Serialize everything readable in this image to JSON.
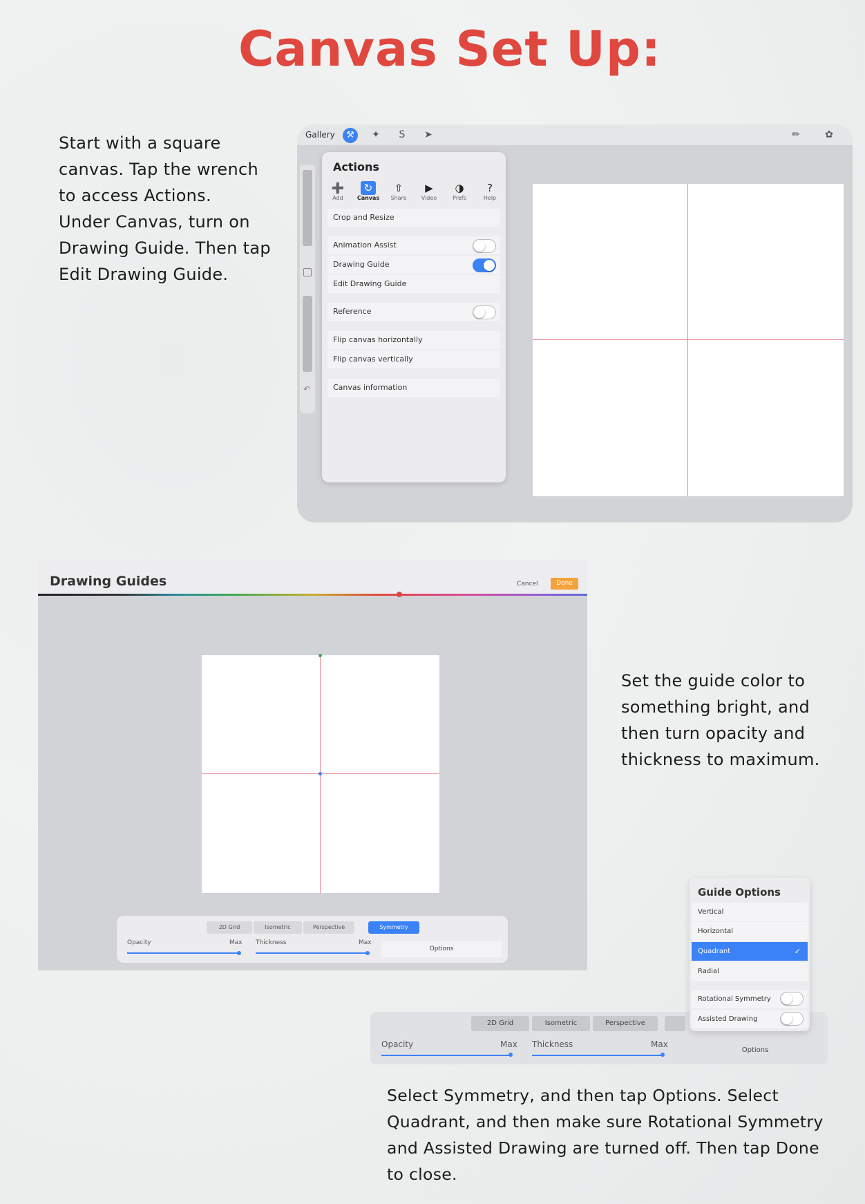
{
  "title": "Canvas Set Up:",
  "instructions": {
    "step1": [
      "Start with a square",
      "canvas. Tap the wrench",
      "to access Actions.",
      "Under Canvas, turn on",
      "Drawing Guide. Then tap",
      "Edit Drawing Guide."
    ],
    "step2": [
      "Set the guide color to",
      "something bright, and",
      "then turn opacity and",
      "thickness to maximum."
    ],
    "step3": [
      "Select Symmetry, and then tap Options. Select",
      "Quadrant, and then make sure Rotational Symmetry",
      "and Assisted Drawing are turned off. Then tap Done",
      "to close."
    ]
  },
  "actions_panel": {
    "gallery_label": "Gallery",
    "title": "Actions",
    "tabs": [
      {
        "label": "Add",
        "icon": "add-icon",
        "glyph": "➕"
      },
      {
        "label": "Canvas",
        "icon": "canvas-icon",
        "glyph": "↻"
      },
      {
        "label": "Share",
        "icon": "share-icon",
        "glyph": "⇧"
      },
      {
        "label": "Video",
        "icon": "video-icon",
        "glyph": "▶"
      },
      {
        "label": "Prefs",
        "icon": "prefs-icon",
        "glyph": "◑"
      },
      {
        "label": "Help",
        "icon": "help-icon",
        "glyph": "?"
      }
    ],
    "rows": {
      "crop_resize": "Crop and Resize",
      "animation_assist": "Animation Assist",
      "drawing_guide": "Drawing Guide",
      "edit_drawing_guide": "Edit Drawing Guide",
      "reference": "Reference",
      "flip_h": "Flip canvas horizontally",
      "flip_v": "Flip canvas vertically",
      "canvas_info": "Canvas information"
    },
    "toggles": {
      "animation_assist": false,
      "drawing_guide": true,
      "reference": false
    }
  },
  "drawing_guides": {
    "title": "Drawing Guides",
    "cancel": "Cancel",
    "done": "Done",
    "tabs": [
      "2D Grid",
      "Isometric",
      "Perspective",
      "Symmetry"
    ],
    "selected_tab": "Symmetry",
    "opacity_label": "Opacity",
    "opacity_max": "Max",
    "thickness_label": "Thickness",
    "thickness_max": "Max",
    "options": "Options"
  },
  "guide_options": {
    "title": "Guide Options",
    "items": [
      "Vertical",
      "Horizontal",
      "Quadrant",
      "Radial"
    ],
    "selected": "Quadrant",
    "rotational_symmetry": "Rotational Symmetry",
    "assisted_drawing": "Assisted Drawing",
    "rotational_on": false,
    "assisted_on": false
  },
  "colors": {
    "title_red": "#e0473f",
    "accent_blue": "#3b82f6",
    "done_orange": "#f3a33a",
    "guide_line": "#e58a99"
  }
}
